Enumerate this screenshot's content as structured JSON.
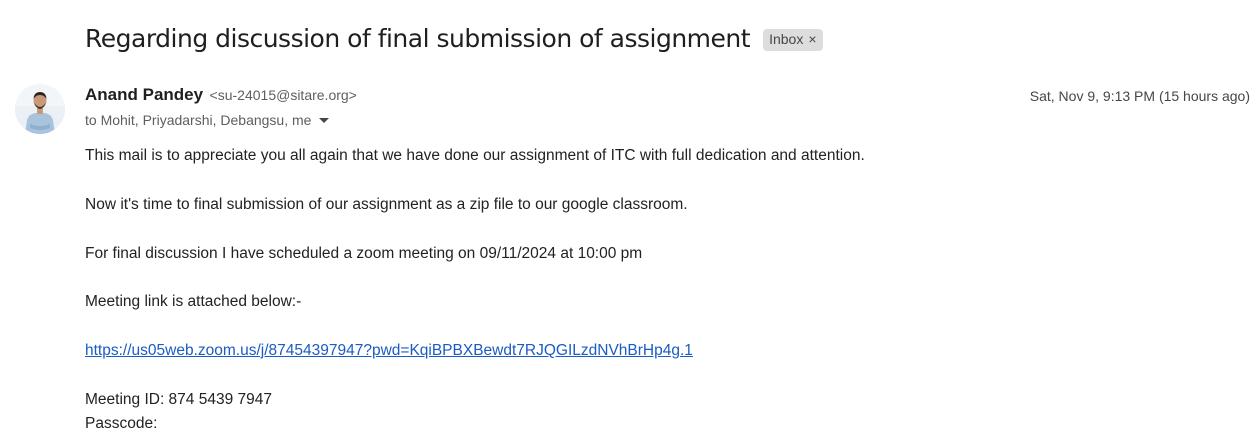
{
  "email": {
    "subject": "Regarding discussion of final submission of assignment",
    "label": "Inbox",
    "label_remove": "×",
    "sender_name": "Anand Pandey",
    "sender_email": "<su-24015@sitare.org>",
    "date": "Sat, Nov 9, 9:13 PM (15 hours ago)",
    "recipients": "to Mohit, Priyadarshi, Debangsu, me"
  },
  "body": {
    "line1": "This mail is to appreciate you all again that we have done our assignment of ITC with full dedication and attention.",
    "line2": "Now it's time to final submission of our assignment as a zip file to our google classroom.",
    "line3": "For final discussion I have scheduled a zoom meeting on 09/11/2024 at 10:00 pm",
    "line4": "Meeting link is attached below:-",
    "link": "https://us05web.zoom.us/j/87454397947?pwd=KqiBPBXBewdt7RJQGILzdNVhBrHp4g.1",
    "meeting_id": "Meeting ID: 874 5439 7947",
    "passcode": "Passcode:"
  },
  "icons": {
    "avatar": "user-avatar-photo",
    "recipients_toggle": "caret-down-icon",
    "label_remove": "close-icon"
  }
}
